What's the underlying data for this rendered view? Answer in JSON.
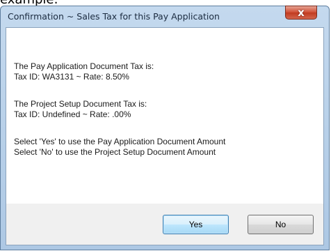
{
  "above_text": "example:",
  "dialog": {
    "title": "Confirmation ~ Sales Tax for this Pay Application",
    "close_glyph": "x",
    "messages": {
      "pay_app_heading": "The Pay Application Document Tax is:",
      "pay_app_tax": "Tax ID: WA3131  ~  Rate: 8.50%",
      "project_heading": "The Project Setup Document Tax is:",
      "project_tax": "Tax ID: Undefined  ~  Rate: .00%",
      "select_yes": "Select 'Yes' to use the Pay Application Document Amount",
      "select_no": "Select 'No' to use the Project Setup Document Amount"
    },
    "buttons": {
      "yes": "Yes",
      "no": "No"
    }
  }
}
